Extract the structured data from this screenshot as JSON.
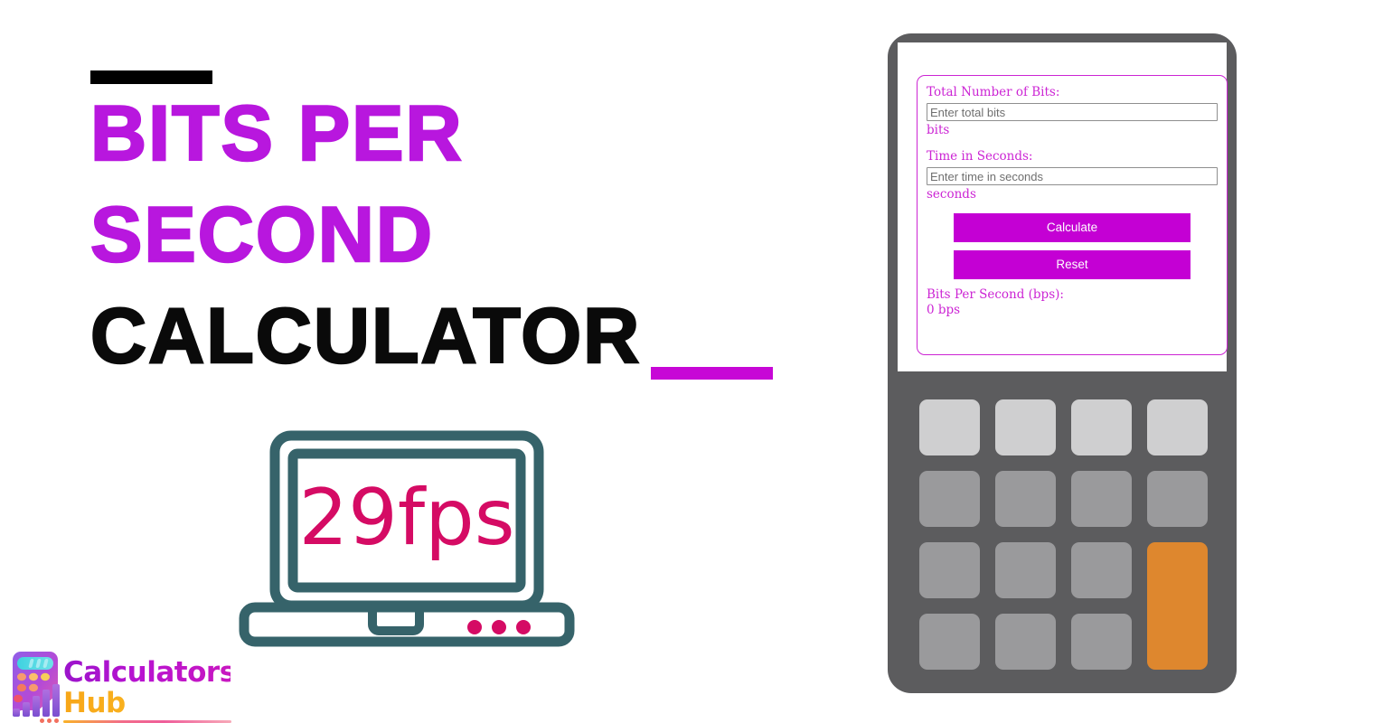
{
  "hero": {
    "title_lines": [
      {
        "text": "Bits Per",
        "color": "#b817de"
      },
      {
        "text": "Second",
        "color": "#b817de"
      },
      {
        "text": "Calculator",
        "color": "#0a0a0a"
      }
    ],
    "accent_bar_top_color": "#000000",
    "accent_bar_bottom_color": "#c707d6"
  },
  "illustration": {
    "name": "laptop-fps-illustration",
    "screen_text": "29fps",
    "outline_color": "#36636a",
    "text_color": "#d50b64"
  },
  "logo": {
    "line1": "Calculators",
    "line2": "Hub",
    "line1_color": "#a516c8",
    "line2_color": "#f4a81e"
  },
  "calculator": {
    "device_color": "#5c5c5e",
    "accent_color": "#c400d4",
    "border_color": "#cc25d4",
    "fields": [
      {
        "label": "Total Number of Bits:",
        "placeholder": "Enter total bits",
        "value": "",
        "unit": "bits"
      },
      {
        "label": "Time in Seconds:",
        "placeholder": "Enter time in seconds",
        "value": "",
        "unit": "seconds"
      }
    ],
    "buttons": {
      "calculate": "Calculate",
      "reset": "Reset"
    },
    "result": {
      "label": "Bits Per Second (bps):",
      "value": "0 bps"
    },
    "keypad": {
      "rows": 4,
      "columns": 4,
      "top_row_color": "#cfcfd0",
      "key_color": "#9a9a9c",
      "enter_key_color": "#de872e"
    }
  }
}
